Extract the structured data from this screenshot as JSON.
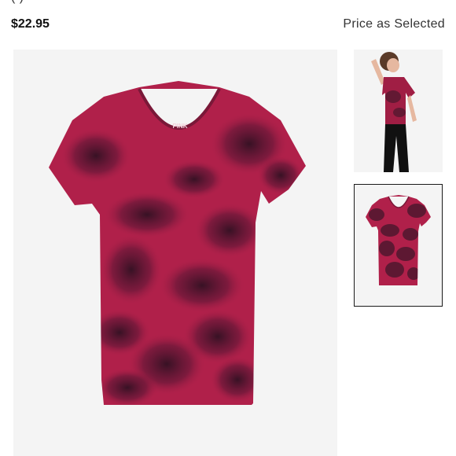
{
  "header": {
    "title_fragment": "(  )",
    "price": "$22.95",
    "price_note": "Price as Selected"
  },
  "product": {
    "main_image_alt": "tie-dye-v-neck-tee",
    "brand_mark": "PINK",
    "colors": {
      "shirt_base": "#b0204a",
      "shirt_dark": "#3a1528",
      "shirt_mid": "#7a1838",
      "background": "#f4f4f4"
    }
  },
  "gallery": {
    "thumbnails": [
      {
        "alt": "model-wearing-tee"
      },
      {
        "alt": "tee-flat-lay",
        "selected": true
      }
    ]
  }
}
